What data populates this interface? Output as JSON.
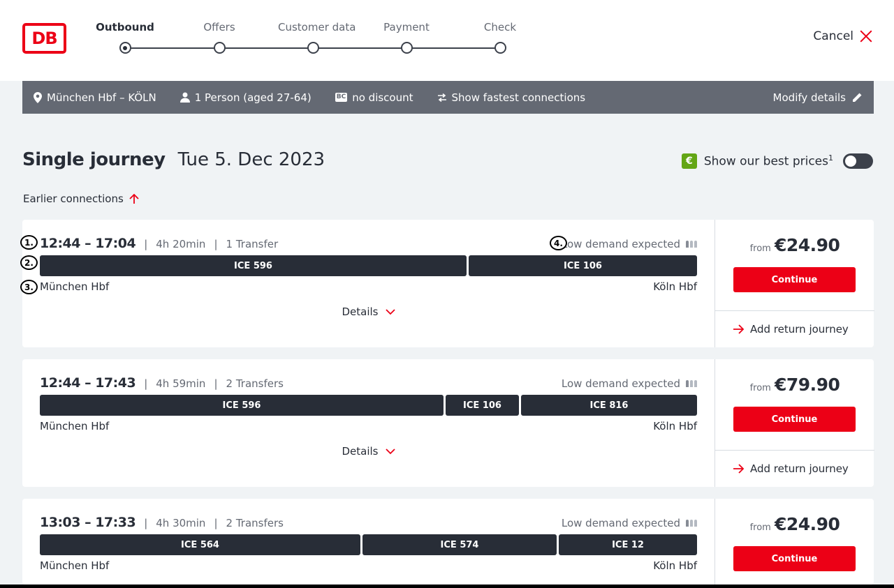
{
  "header": {
    "logo_text": "DB",
    "steps": [
      {
        "label": "Outbound",
        "active": true
      },
      {
        "label": "Offers",
        "active": false
      },
      {
        "label": "Customer data",
        "active": false
      },
      {
        "label": "Payment",
        "active": false
      },
      {
        "label": "Check",
        "active": false
      }
    ],
    "cancel_label": "Cancel"
  },
  "summary": {
    "route": "München Hbf – KÖLN",
    "passengers": "1 Person (aged 27-64)",
    "bc_badge": "BC",
    "discount": "no discount",
    "fastest": "Show fastest connections",
    "modify": "Modify details"
  },
  "journey": {
    "type": "Single journey",
    "date": "Tue 5. Dec 2023",
    "best_prices": "Show our best prices",
    "best_prices_sup": "1",
    "euro_symbol": "€",
    "earlier": "Earlier connections"
  },
  "annotations": [
    "1.",
    "2.",
    "3.",
    "4."
  ],
  "connections": [
    {
      "time": "12:44 – 17:04",
      "duration": "4h 20min",
      "transfers": "1 Transfer",
      "demand": "Low demand expected",
      "segments": [
        "ICE 596",
        "ICE 106"
      ],
      "from_station": "München Hbf",
      "to_station": "Köln Hbf",
      "details": "Details",
      "from_label": "from",
      "price": "€24.90",
      "continue": "Continue",
      "return": "Add return journey"
    },
    {
      "time": "12:44 – 17:43",
      "duration": "4h 59min",
      "transfers": "2 Transfers",
      "demand": "Low demand expected",
      "segments": [
        "ICE 596",
        "ICE 106",
        "ICE 816"
      ],
      "from_station": "München Hbf",
      "to_station": "Köln Hbf",
      "details": "Details",
      "from_label": "from",
      "price": "€79.90",
      "continue": "Continue",
      "return": "Add return journey"
    },
    {
      "time": "13:03 – 17:33",
      "duration": "4h 30min",
      "transfers": "2 Transfers",
      "demand": "Low demand expected",
      "segments": [
        "ICE 564",
        "ICE 574",
        "ICE 12"
      ],
      "from_station": "München Hbf",
      "to_station": "Köln Hbf",
      "from_label": "from",
      "price": "€24.90",
      "continue": "Continue"
    }
  ],
  "colors": {
    "brand_red": "#ec0016",
    "summary_bg": "#646973",
    "segment_bg": "#282d37",
    "page_bg": "#f0f3f5"
  }
}
